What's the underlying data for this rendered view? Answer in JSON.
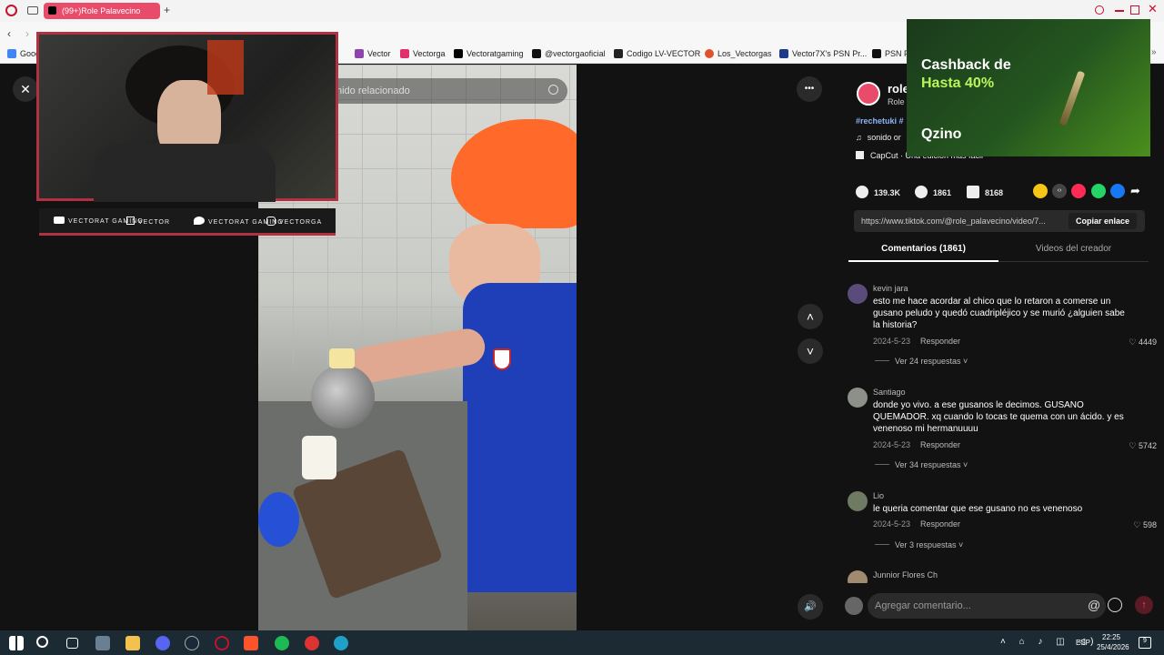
{
  "browser": {
    "tab_title": "(99+)Role Palavecino",
    "new_tab": "+",
    "bookmarks": [
      {
        "label": "Goog",
        "color": "#4285f4"
      },
      {
        "label": "Vector",
        "color": "#8e44ad"
      },
      {
        "label": "Vectorga",
        "color": "#e1306c"
      },
      {
        "label": "Vectoratgaming",
        "color": "#000000"
      },
      {
        "label": "@vectorgaoficial",
        "color": "#111111"
      },
      {
        "label": "Codigo LV-VECTOR",
        "color": "#222222"
      },
      {
        "label": "Los_Vectorgas",
        "color": "#e0522c"
      },
      {
        "label": "Vector7X's PSN Pr...",
        "color": "#1e3a8a"
      },
      {
        "label": "PSN P",
        "color": "#111111"
      }
    ]
  },
  "overlay": {
    "socials": [
      "VECTORAT GAMING",
      "VECTOR",
      "VECTORAT GAMING",
      "VECTORGA"
    ]
  },
  "video": {
    "search_placeholder": "nido relacionado",
    "close": "✕",
    "more": "•••",
    "up": "˄",
    "down": "˅",
    "volume": "🔊"
  },
  "ad": {
    "line1": "Cashback de",
    "line2": "Hasta 40%",
    "brand": "Qzino"
  },
  "creator": {
    "name": "role",
    "subname": "Role",
    "hashtags": "#rechetuki #",
    "sound": "sonido or",
    "capcut": "CapCut · Una edición más fácil"
  },
  "stats": {
    "likes": "139.3K",
    "comments": "1861",
    "saves": "8168"
  },
  "link": {
    "url": "https://www.tiktok.com/@role_palavecino/video/7...",
    "copy_label": "Copiar enlace"
  },
  "tabs": {
    "comments": "Comentarios (1861)",
    "videos": "Videos del creador"
  },
  "comments": [
    {
      "user": "kevin jara",
      "text": "esto me hace acordar al chico que lo retaron a comerse un gusano peludo y quedó cuadripléjico y se murió ¿alguien sabe la historia?",
      "date": "2024-5-23",
      "reply": "Responder",
      "likes": "4449",
      "more": "Ver 24 respuestas"
    },
    {
      "user": "Santiago",
      "text": "donde yo vivo. a ese gusanos le decimos. GUSANO QUEMADOR. xq cuando lo tocas te quema con un ácido. y es venenoso mi hermanuuuu",
      "date": "2024-5-23",
      "reply": "Responder",
      "likes": "5742",
      "more": "Ver 34 respuestas"
    },
    {
      "user": "Lio",
      "text": "le queria comentar que ese gusano no es venenoso",
      "date": "2024-5-23",
      "reply": "Responder",
      "likes": "598",
      "more": "Ver 3 respuestas"
    },
    {
      "user": "Junnior Flores Ch",
      "text": "",
      "date": "",
      "reply": "",
      "likes": "",
      "more": ""
    }
  ],
  "comment_input": {
    "placeholder": "Agregar comentario..."
  },
  "taskbar": {
    "lang": "ESP",
    "time": "22:25",
    "date": "25/4/2026",
    "notifications": "9"
  }
}
